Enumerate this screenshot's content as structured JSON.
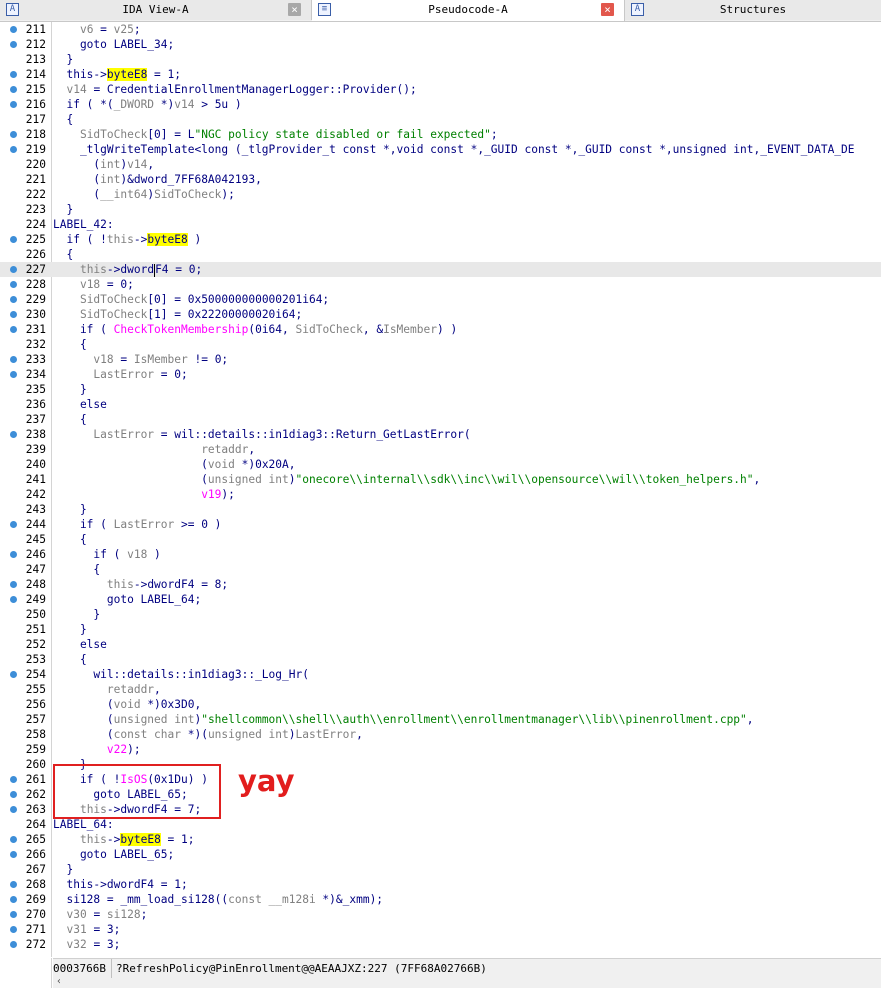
{
  "tabs": [
    {
      "label": "IDA View-A",
      "icon": "A",
      "active": false
    },
    {
      "label": "Pseudocode-A",
      "icon": "≡",
      "active": true
    },
    {
      "label": "Structures",
      "icon": "A",
      "active": false
    }
  ],
  "lines": [
    {
      "n": "211",
      "dot": true,
      "t": [
        [
          "    ",
          "k"
        ],
        [
          "v6",
          "g"
        ],
        [
          " = ",
          "k"
        ],
        [
          "v25",
          "g"
        ],
        [
          ";",
          "k"
        ]
      ]
    },
    {
      "n": "212",
      "dot": true,
      "t": [
        [
          "    goto LABEL_34;",
          "k"
        ]
      ]
    },
    {
      "n": "213",
      "dot": false,
      "t": [
        [
          "  }",
          "k"
        ]
      ]
    },
    {
      "n": "214",
      "dot": true,
      "t": [
        [
          "  this->",
          "k"
        ],
        [
          "byteE8",
          "y"
        ],
        [
          " = 1;",
          "k"
        ]
      ]
    },
    {
      "n": "215",
      "dot": true,
      "t": [
        [
          "  ",
          "k"
        ],
        [
          "v14",
          "g"
        ],
        [
          " = CredentialEnrollmentManagerLogger::Provider();",
          "k"
        ]
      ]
    },
    {
      "n": "216",
      "dot": true,
      "t": [
        [
          "  if ( *(",
          "k"
        ],
        [
          "_DWORD",
          "g"
        ],
        [
          " *)",
          "k"
        ],
        [
          "v14",
          "g"
        ],
        [
          " > 5u )",
          "k"
        ]
      ]
    },
    {
      "n": "217",
      "dot": false,
      "t": [
        [
          "  {",
          "k"
        ]
      ]
    },
    {
      "n": "218",
      "dot": true,
      "t": [
        [
          "    ",
          "k"
        ],
        [
          "SidToCheck",
          "g"
        ],
        [
          "[0] = L",
          "k"
        ],
        [
          "\"NGC policy state disabled or fail expected\"",
          "gr"
        ],
        [
          ";",
          "k"
        ]
      ]
    },
    {
      "n": "219",
      "dot": true,
      "t": [
        [
          "    _tlgWriteTemplate<long (_tlgProvider_t const *,void const *,_GUID const *,_GUID const *,unsigned int,_EVENT_DATA_DE",
          "k"
        ]
      ]
    },
    {
      "n": "220",
      "dot": false,
      "t": [
        [
          "      (",
          "k"
        ],
        [
          "int",
          "g"
        ],
        [
          ")",
          "k"
        ],
        [
          "v14",
          "g"
        ],
        [
          ",",
          "k"
        ]
      ]
    },
    {
      "n": "221",
      "dot": false,
      "t": [
        [
          "      (",
          "k"
        ],
        [
          "int",
          "g"
        ],
        [
          ")&dword_7FF68A042193,",
          "k"
        ]
      ]
    },
    {
      "n": "222",
      "dot": false,
      "t": [
        [
          "      (",
          "k"
        ],
        [
          "__int64",
          "g"
        ],
        [
          ")",
          "k"
        ],
        [
          "SidToCheck",
          "g"
        ],
        [
          ");",
          "k"
        ]
      ]
    },
    {
      "n": "223",
      "dot": false,
      "t": [
        [
          "  }",
          "k"
        ]
      ]
    },
    {
      "n": "224",
      "dot": false,
      "t": [
        [
          "LABEL_42:",
          "k"
        ]
      ]
    },
    {
      "n": "225",
      "dot": true,
      "t": [
        [
          "  if ( !",
          "k"
        ],
        [
          "this",
          "g"
        ],
        [
          "->",
          "k"
        ],
        [
          "byteE8",
          "y"
        ],
        [
          " )",
          "k"
        ]
      ]
    },
    {
      "n": "226",
      "dot": false,
      "t": [
        [
          "  {",
          "k"
        ]
      ]
    },
    {
      "n": "227",
      "dot": true,
      "hl": true,
      "t": [
        [
          "    ",
          "k"
        ],
        [
          "this",
          "g"
        ],
        [
          "->dword",
          "k"
        ],
        [
          "|",
          "c"
        ],
        [
          "F4 = 0;",
          "k"
        ]
      ]
    },
    {
      "n": "228",
      "dot": true,
      "t": [
        [
          "    ",
          "k"
        ],
        [
          "v18",
          "g"
        ],
        [
          " = 0;",
          "k"
        ]
      ]
    },
    {
      "n": "229",
      "dot": true,
      "t": [
        [
          "    ",
          "k"
        ],
        [
          "SidToCheck",
          "g"
        ],
        [
          "[0] = 0x500000000000201i64;",
          "k"
        ]
      ]
    },
    {
      "n": "230",
      "dot": true,
      "t": [
        [
          "    ",
          "k"
        ],
        [
          "SidToCheck",
          "g"
        ],
        [
          "[1] = 0x22200000020i64;",
          "k"
        ]
      ]
    },
    {
      "n": "231",
      "dot": true,
      "t": [
        [
          "    if ( ",
          "k"
        ],
        [
          "CheckTokenMembership",
          "m"
        ],
        [
          "(0i64, ",
          "k"
        ],
        [
          "SidToCheck",
          "g"
        ],
        [
          ", &",
          "k"
        ],
        [
          "IsMember",
          "g"
        ],
        [
          ") )",
          "k"
        ]
      ]
    },
    {
      "n": "232",
      "dot": false,
      "t": [
        [
          "    {",
          "k"
        ]
      ]
    },
    {
      "n": "233",
      "dot": true,
      "t": [
        [
          "      ",
          "k"
        ],
        [
          "v18",
          "g"
        ],
        [
          " = ",
          "k"
        ],
        [
          "IsMember",
          "g"
        ],
        [
          " != 0;",
          "k"
        ]
      ]
    },
    {
      "n": "234",
      "dot": true,
      "t": [
        [
          "      ",
          "k"
        ],
        [
          "LastError",
          "g"
        ],
        [
          " = 0;",
          "k"
        ]
      ]
    },
    {
      "n": "235",
      "dot": false,
      "t": [
        [
          "    }",
          "k"
        ]
      ]
    },
    {
      "n": "236",
      "dot": false,
      "t": [
        [
          "    else",
          "k"
        ]
      ]
    },
    {
      "n": "237",
      "dot": false,
      "t": [
        [
          "    {",
          "k"
        ]
      ]
    },
    {
      "n": "238",
      "dot": true,
      "t": [
        [
          "      ",
          "k"
        ],
        [
          "LastError",
          "g"
        ],
        [
          " = wil::details::in1diag3::Return_GetLastError(",
          "k"
        ]
      ]
    },
    {
      "n": "239",
      "dot": false,
      "t": [
        [
          "                      ",
          "k"
        ],
        [
          "retaddr",
          "g"
        ],
        [
          ",",
          "k"
        ]
      ]
    },
    {
      "n": "240",
      "dot": false,
      "t": [
        [
          "                      (",
          "k"
        ],
        [
          "void",
          "g"
        ],
        [
          " *)0x20A,",
          "k"
        ]
      ]
    },
    {
      "n": "241",
      "dot": false,
      "t": [
        [
          "                      (",
          "k"
        ],
        [
          "unsigned int",
          "g"
        ],
        [
          ")",
          "k"
        ],
        [
          "\"onecore\\\\internal\\\\sdk\\\\inc\\\\wil\\\\opensource\\\\wil\\\\token_helpers.h\"",
          "gr"
        ],
        [
          ",",
          "k"
        ]
      ]
    },
    {
      "n": "242",
      "dot": false,
      "t": [
        [
          "                      ",
          "k"
        ],
        [
          "v19",
          "m"
        ],
        [
          ");",
          "k"
        ]
      ]
    },
    {
      "n": "243",
      "dot": false,
      "t": [
        [
          "    }",
          "k"
        ]
      ]
    },
    {
      "n": "244",
      "dot": true,
      "t": [
        [
          "    if ( ",
          "k"
        ],
        [
          "LastError",
          "g"
        ],
        [
          " >= 0 )",
          "k"
        ]
      ]
    },
    {
      "n": "245",
      "dot": false,
      "t": [
        [
          "    {",
          "k"
        ]
      ]
    },
    {
      "n": "246",
      "dot": true,
      "t": [
        [
          "      if ( ",
          "k"
        ],
        [
          "v18",
          "g"
        ],
        [
          " )",
          "k"
        ]
      ]
    },
    {
      "n": "247",
      "dot": false,
      "t": [
        [
          "      {",
          "k"
        ]
      ]
    },
    {
      "n": "248",
      "dot": true,
      "t": [
        [
          "        ",
          "k"
        ],
        [
          "this",
          "g"
        ],
        [
          "->dwordF4 = 8;",
          "k"
        ]
      ]
    },
    {
      "n": "249",
      "dot": true,
      "t": [
        [
          "        goto LABEL_64;",
          "k"
        ]
      ]
    },
    {
      "n": "250",
      "dot": false,
      "t": [
        [
          "      }",
          "k"
        ]
      ]
    },
    {
      "n": "251",
      "dot": false,
      "t": [
        [
          "    }",
          "k"
        ]
      ]
    },
    {
      "n": "252",
      "dot": false,
      "t": [
        [
          "    else",
          "k"
        ]
      ]
    },
    {
      "n": "253",
      "dot": false,
      "t": [
        [
          "    {",
          "k"
        ]
      ]
    },
    {
      "n": "254",
      "dot": true,
      "t": [
        [
          "      wil::details::in1diag3::_Log_Hr(",
          "k"
        ]
      ]
    },
    {
      "n": "255",
      "dot": false,
      "t": [
        [
          "        ",
          "k"
        ],
        [
          "retaddr",
          "g"
        ],
        [
          ",",
          "k"
        ]
      ]
    },
    {
      "n": "256",
      "dot": false,
      "t": [
        [
          "        (",
          "k"
        ],
        [
          "void",
          "g"
        ],
        [
          " *)0x3D0,",
          "k"
        ]
      ]
    },
    {
      "n": "257",
      "dot": false,
      "t": [
        [
          "        (",
          "k"
        ],
        [
          "unsigned int",
          "g"
        ],
        [
          ")",
          "k"
        ],
        [
          "\"shellcommon\\\\shell\\\\auth\\\\enrollment\\\\enrollmentmanager\\\\lib\\\\pinenrollment.cpp\"",
          "gr"
        ],
        [
          ",",
          "k"
        ]
      ]
    },
    {
      "n": "258",
      "dot": false,
      "t": [
        [
          "        (",
          "k"
        ],
        [
          "const char",
          "g"
        ],
        [
          " *)(",
          "k"
        ],
        [
          "unsigned int",
          "g"
        ],
        [
          ")",
          "k"
        ],
        [
          "LastError",
          "g"
        ],
        [
          ",",
          "k"
        ]
      ]
    },
    {
      "n": "259",
      "dot": false,
      "t": [
        [
          "        ",
          "k"
        ],
        [
          "v22",
          "m"
        ],
        [
          ");",
          "k"
        ]
      ]
    },
    {
      "n": "260",
      "dot": false,
      "t": [
        [
          "    }",
          "k"
        ]
      ]
    },
    {
      "n": "261",
      "dot": true,
      "t": [
        [
          "    if ( !",
          "k"
        ],
        [
          "IsOS",
          "m"
        ],
        [
          "(0x1Du) )",
          "k"
        ]
      ]
    },
    {
      "n": "262",
      "dot": true,
      "t": [
        [
          "      goto LABEL_65;",
          "k"
        ]
      ]
    },
    {
      "n": "263",
      "dot": true,
      "t": [
        [
          "    ",
          "k"
        ],
        [
          "this",
          "g"
        ],
        [
          "->dwordF4 = 7;",
          "k"
        ]
      ]
    },
    {
      "n": "264",
      "dot": false,
      "t": [
        [
          "LABEL_64:",
          "k"
        ]
      ]
    },
    {
      "n": "265",
      "dot": true,
      "t": [
        [
          "    ",
          "k"
        ],
        [
          "this",
          "g"
        ],
        [
          "->",
          "k"
        ],
        [
          "byteE8",
          "y"
        ],
        [
          " = 1;",
          "k"
        ]
      ]
    },
    {
      "n": "266",
      "dot": true,
      "t": [
        [
          "    goto LABEL_65;",
          "k"
        ]
      ]
    },
    {
      "n": "267",
      "dot": false,
      "t": [
        [
          "  }",
          "k"
        ]
      ]
    },
    {
      "n": "268",
      "dot": true,
      "t": [
        [
          "  this->dwordF4 = 1;",
          "k"
        ]
      ]
    },
    {
      "n": "269",
      "dot": true,
      "t": [
        [
          "  si128 = _mm_load_si128((",
          "k"
        ],
        [
          "const __m128i",
          "g"
        ],
        [
          " *)&_xmm);",
          "k"
        ]
      ]
    },
    {
      "n": "270",
      "dot": true,
      "t": [
        [
          "  ",
          "k"
        ],
        [
          "v30",
          "g"
        ],
        [
          " = ",
          "k"
        ],
        [
          "si128",
          "g"
        ],
        [
          ";",
          "k"
        ]
      ]
    },
    {
      "n": "271",
      "dot": true,
      "t": [
        [
          "  ",
          "k"
        ],
        [
          "v31",
          "g"
        ],
        [
          " = 3;",
          "k"
        ]
      ]
    },
    {
      "n": "272",
      "dot": true,
      "t": [
        [
          "  ",
          "k"
        ],
        [
          "v32",
          "g"
        ],
        [
          " = 3;",
          "k"
        ]
      ]
    }
  ],
  "annotation": {
    "text": "yay"
  },
  "status": {
    "address": "0003766B",
    "location": "?RefreshPolicy@PinEnrollment@@AEAAJXZ:227 (7FF68A02766B)"
  },
  "scroll": {
    "left_arrow": "‹"
  },
  "colors": {
    "keyword": "#000080",
    "grey_var": "#808080",
    "magenta": "#ff00ff",
    "string": "#008000",
    "highlight": "#ffff00",
    "annotation": "#e21d1d"
  }
}
